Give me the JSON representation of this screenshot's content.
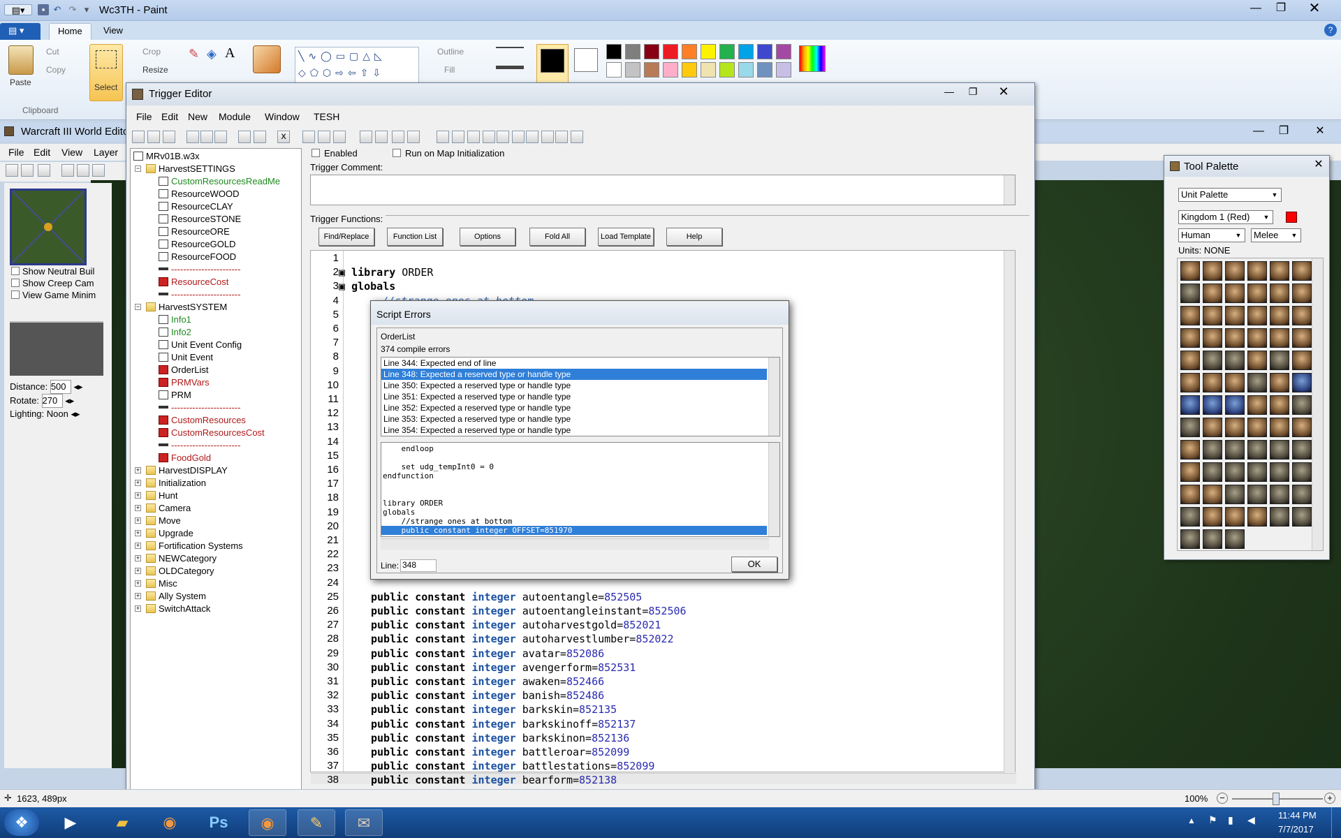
{
  "paint": {
    "title": "Wc3TH - Paint",
    "tabs": [
      "Home",
      "View"
    ],
    "groups": {
      "clipboard": "Clipboard",
      "paste": "Paste",
      "cut": "Cut",
      "copy": "Copy",
      "select": "Select",
      "crop": "Crop",
      "resize": "Resize",
      "outline": "Outline",
      "fill": "Fill",
      "brushes": "Brushes",
      "size": "Size",
      "color1": "Color 1",
      "color2": "Color 2",
      "edit_colors": "Edit colors"
    },
    "palette_row1": [
      "#000000",
      "#7f7f7f",
      "#880015",
      "#ed1c24",
      "#ff7f27",
      "#fff200",
      "#22b14c",
      "#00a2e8",
      "#3f48cc",
      "#a349a4"
    ],
    "palette_row2": [
      "#ffffff",
      "#c3c3c3",
      "#b97a57",
      "#ffaec9",
      "#ffc90e",
      "#efe4b0",
      "#b5e61d",
      "#99d9ea",
      "#7092be",
      "#c8bfe7"
    ],
    "status_coords": "1623, 489px",
    "zoom": "100%"
  },
  "we": {
    "title": "Warcraft III World Editor",
    "menu": [
      "File",
      "Edit",
      "View",
      "Layer"
    ],
    "options": [
      "Show Neutral Buil",
      "Show Creep Cam",
      "View Game Minim"
    ],
    "distance_label": "Distance:",
    "distance": "500",
    "rotate_label": "Rotate:",
    "rotate": "270",
    "lighting_label": "Lighting:",
    "lighting": "Noon"
  },
  "te": {
    "title": "Trigger Editor",
    "menu": [
      "File",
      "Edit",
      "New",
      "Module",
      "Window",
      "TESH"
    ],
    "enabled": "Enabled",
    "run_on_init": "Run on Map Initialization",
    "comment_label": "Trigger Comment:",
    "functions_label": "Trigger Functions:",
    "buttons": [
      "Find/Replace",
      "Function List",
      "Options",
      "Fold All",
      "Load Template",
      "Help"
    ],
    "tree": [
      {
        "label": "MRv01B.w3x",
        "kind": "root",
        "depth": 0,
        "color": "black"
      },
      {
        "label": "HarvestSETTINGS",
        "kind": "folder",
        "depth": 1,
        "color": "black"
      },
      {
        "label": "CustomResourcesReadMe",
        "kind": "doc",
        "depth": 2,
        "color": "green"
      },
      {
        "label": "ResourceWOOD",
        "kind": "doc",
        "depth": 2,
        "color": "black"
      },
      {
        "label": "ResourceCLAY",
        "kind": "doc",
        "depth": 2,
        "color": "black"
      },
      {
        "label": "ResourceSTONE",
        "kind": "doc",
        "depth": 2,
        "color": "black"
      },
      {
        "label": "ResourceORE",
        "kind": "doc",
        "depth": 2,
        "color": "black"
      },
      {
        "label": "ResourceGOLD",
        "kind": "doc",
        "depth": 2,
        "color": "black"
      },
      {
        "label": "ResourceFOOD",
        "kind": "doc",
        "depth": 2,
        "color": "black"
      },
      {
        "label": "-----------------------",
        "kind": "dash",
        "depth": 2,
        "color": "red"
      },
      {
        "label": "ResourceCost",
        "kind": "err",
        "depth": 2,
        "color": "red"
      },
      {
        "label": "-----------------------",
        "kind": "dash",
        "depth": 2,
        "color": "red"
      },
      {
        "label": "HarvestSYSTEM",
        "kind": "folder",
        "depth": 1,
        "color": "black"
      },
      {
        "label": "Info1",
        "kind": "doc",
        "depth": 2,
        "color": "green"
      },
      {
        "label": "Info2",
        "kind": "doc",
        "depth": 2,
        "color": "green"
      },
      {
        "label": "Unit Event Config",
        "kind": "doc",
        "depth": 2,
        "color": "black"
      },
      {
        "label": "Unit Event",
        "kind": "doc",
        "depth": 2,
        "color": "black"
      },
      {
        "label": "OrderList",
        "kind": "err",
        "depth": 2,
        "color": "black"
      },
      {
        "label": "PRMVars",
        "kind": "err",
        "depth": 2,
        "color": "red"
      },
      {
        "label": "PRM",
        "kind": "doc",
        "depth": 2,
        "color": "black"
      },
      {
        "label": "-----------------------",
        "kind": "dash",
        "depth": 2,
        "color": "red"
      },
      {
        "label": "CustomResources",
        "kind": "err",
        "depth": 2,
        "color": "red"
      },
      {
        "label": "CustomResourcesCost",
        "kind": "err",
        "depth": 2,
        "color": "red"
      },
      {
        "label": "-----------------------",
        "kind": "dash",
        "depth": 2,
        "color": "red"
      },
      {
        "label": "FoodGold",
        "kind": "err",
        "depth": 2,
        "color": "red"
      },
      {
        "label": "HarvestDISPLAY",
        "kind": "folder",
        "depth": 1,
        "color": "black"
      },
      {
        "label": "Initialization",
        "kind": "folder",
        "depth": 1,
        "color": "black"
      },
      {
        "label": "Hunt",
        "kind": "folder",
        "depth": 1,
        "color": "black"
      },
      {
        "label": "Camera",
        "kind": "folder",
        "depth": 1,
        "color": "black"
      },
      {
        "label": "Move",
        "kind": "folder",
        "depth": 1,
        "color": "black"
      },
      {
        "label": "Upgrade",
        "kind": "folder",
        "depth": 1,
        "color": "black"
      },
      {
        "label": "Fortification Systems",
        "kind": "folder",
        "depth": 1,
        "color": "black"
      },
      {
        "label": "NEWCategory",
        "kind": "folder",
        "depth": 1,
        "color": "black"
      },
      {
        "label": "OLDCategory",
        "kind": "folder",
        "depth": 1,
        "color": "black"
      },
      {
        "label": "Misc",
        "kind": "folder",
        "depth": 1,
        "color": "black"
      },
      {
        "label": "Ally System",
        "kind": "folder",
        "depth": 1,
        "color": "black"
      },
      {
        "label": "SwitchAttack",
        "kind": "folder",
        "depth": 1,
        "color": "black"
      }
    ],
    "code_top": [
      {
        "n": "1",
        "t": ""
      },
      {
        "n": "2",
        "t": "library ORDER",
        "k": "lib"
      },
      {
        "n": "3",
        "t": "globals",
        "k": "glob"
      },
      {
        "n": "4",
        "t": "    //strange ones at bottom",
        "k": "cm"
      }
    ],
    "code_bottom": [
      {
        "n": "25",
        "name": "autoentangle",
        "val": "852505"
      },
      {
        "n": "26",
        "name": "autoentangleinstant",
        "val": "852506"
      },
      {
        "n": "27",
        "name": "autoharvestgold",
        "val": "852021"
      },
      {
        "n": "28",
        "name": "autoharvestlumber",
        "val": "852022"
      },
      {
        "n": "29",
        "name": "avatar",
        "val": "852086"
      },
      {
        "n": "30",
        "name": "avengerform",
        "val": "852531"
      },
      {
        "n": "31",
        "name": "awaken",
        "val": "852466"
      },
      {
        "n": "32",
        "name": "banish",
        "val": "852486"
      },
      {
        "n": "33",
        "name": "barkskin",
        "val": "852135"
      },
      {
        "n": "34",
        "name": "barkskinoff",
        "val": "852137"
      },
      {
        "n": "35",
        "name": "barkskinon",
        "val": "852136"
      },
      {
        "n": "36",
        "name": "battleroar",
        "val": "852099"
      },
      {
        "n": "37",
        "name": "battlestations",
        "val": "852099"
      },
      {
        "n": "38",
        "name": "bearform",
        "val": "852138"
      }
    ],
    "hidden_line_numbers": [
      "5",
      "6",
      "7",
      "8",
      "9",
      "10",
      "11",
      "12",
      "13",
      "14",
      "15",
      "16",
      "17",
      "18",
      "19",
      "20",
      "21",
      "22",
      "23",
      "24"
    ],
    "code_prefix": "public constant",
    "code_type": "integer"
  },
  "dialog": {
    "title": "Script Errors",
    "name": "OrderList",
    "count": "374 compile errors",
    "errors": [
      "Line 344: Expected end of line",
      "Line 348: Expected a reserved type or handle type",
      "Line 350: Expected a reserved type or handle type",
      "Line 351: Expected a reserved type or handle type",
      "Line 352: Expected a reserved type or handle type",
      "Line 353: Expected a reserved type or handle type",
      "Line 354: Expected a reserved type or handle type"
    ],
    "selected_index": 1,
    "source": [
      "    endloop",
      "",
      "    set udg_tempInt0 = 0",
      "endfunction",
      "",
      "",
      "library ORDER",
      "globals",
      "    //strange ones at bottom",
      "    public constant integer OFFSET=851970"
    ],
    "line_label": "Line:",
    "line_value": "348",
    "ok": "OK"
  },
  "palette": {
    "title": "Tool Palette",
    "type": "Unit Palette",
    "player": "Kingdom 1 (Red)",
    "player_color": "#ff0000",
    "race": "Human",
    "mode": "Melee",
    "units_label": "Units: NONE"
  },
  "taskbar": {
    "time": "11:44 PM",
    "date": "7/7/2017",
    "apps": [
      "start",
      "media",
      "explorer",
      "chrome",
      "photoshop",
      "chrome",
      "paint",
      "worldedit"
    ]
  }
}
